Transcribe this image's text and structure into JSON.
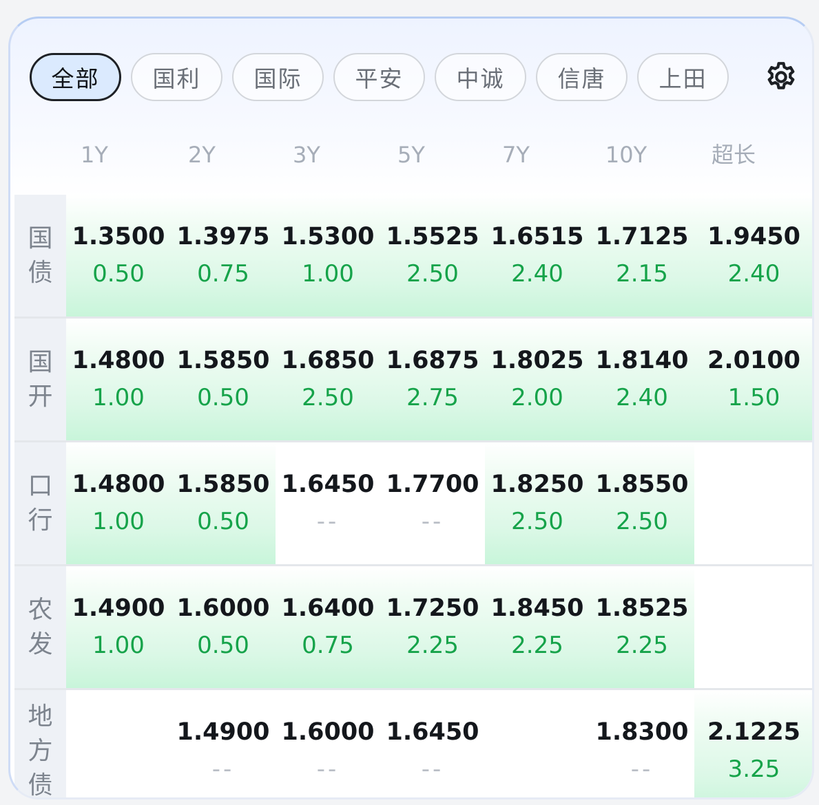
{
  "filters": [
    {
      "label": "全部",
      "active": true
    },
    {
      "label": "国利",
      "active": false
    },
    {
      "label": "国际",
      "active": false
    },
    {
      "label": "平安",
      "active": false
    },
    {
      "label": "中诚",
      "active": false
    },
    {
      "label": "信唐",
      "active": false
    },
    {
      "label": "上田",
      "active": false
    }
  ],
  "settings_icon": "gear-icon",
  "columns": [
    "1Y",
    "2Y",
    "3Y",
    "5Y",
    "7Y",
    "10Y",
    "超长"
  ],
  "colors": {
    "positive_change": "#16a34a",
    "highlight": "#c8f5da",
    "active_pill": "#dbeafe"
  },
  "rows": [
    {
      "label": "国债",
      "cells": [
        {
          "yield": "1.3500",
          "change": "0.50",
          "highlight": true
        },
        {
          "yield": "1.3975",
          "change": "0.75",
          "highlight": true
        },
        {
          "yield": "1.5300",
          "change": "1.00",
          "highlight": true
        },
        {
          "yield": "1.5525",
          "change": "2.50",
          "highlight": true
        },
        {
          "yield": "1.6515",
          "change": "2.40",
          "highlight": true
        },
        {
          "yield": "1.7125",
          "change": "2.15",
          "highlight": true
        },
        {
          "yield": "1.9450",
          "change": "2.40",
          "highlight": true
        }
      ]
    },
    {
      "label": "国开",
      "cells": [
        {
          "yield": "1.4800",
          "change": "1.00",
          "highlight": true
        },
        {
          "yield": "1.5850",
          "change": "0.50",
          "highlight": true
        },
        {
          "yield": "1.6850",
          "change": "2.50",
          "highlight": true
        },
        {
          "yield": "1.6875",
          "change": "2.75",
          "highlight": true
        },
        {
          "yield": "1.8025",
          "change": "2.00",
          "highlight": true
        },
        {
          "yield": "1.8140",
          "change": "2.40",
          "highlight": true
        },
        {
          "yield": "2.0100",
          "change": "1.50",
          "highlight": true
        }
      ]
    },
    {
      "label": "口行",
      "cells": [
        {
          "yield": "1.4800",
          "change": "1.00",
          "highlight": true
        },
        {
          "yield": "1.5850",
          "change": "0.50",
          "highlight": true
        },
        {
          "yield": "1.6450",
          "change": "--",
          "highlight": false
        },
        {
          "yield": "1.7700",
          "change": "--",
          "highlight": false
        },
        {
          "yield": "1.8250",
          "change": "2.50",
          "highlight": true
        },
        {
          "yield": "1.8550",
          "change": "2.50",
          "highlight": true
        },
        null
      ]
    },
    {
      "label": "农发",
      "cells": [
        {
          "yield": "1.4900",
          "change": "1.00",
          "highlight": true
        },
        {
          "yield": "1.6000",
          "change": "0.50",
          "highlight": true
        },
        {
          "yield": "1.6400",
          "change": "0.75",
          "highlight": true
        },
        {
          "yield": "1.7250",
          "change": "2.25",
          "highlight": true
        },
        {
          "yield": "1.8450",
          "change": "2.25",
          "highlight": true
        },
        {
          "yield": "1.8525",
          "change": "2.25",
          "highlight": true
        },
        null
      ]
    },
    {
      "label": "地方债",
      "cells": [
        null,
        {
          "yield": "1.4900",
          "change": "--",
          "highlight": false
        },
        {
          "yield": "1.6000",
          "change": "--",
          "highlight": false
        },
        {
          "yield": "1.6450",
          "change": "--",
          "highlight": false
        },
        null,
        {
          "yield": "1.8300",
          "change": "--",
          "highlight": false
        },
        {
          "yield": "2.1225",
          "change": "3.25",
          "highlight": true
        }
      ]
    }
  ]
}
